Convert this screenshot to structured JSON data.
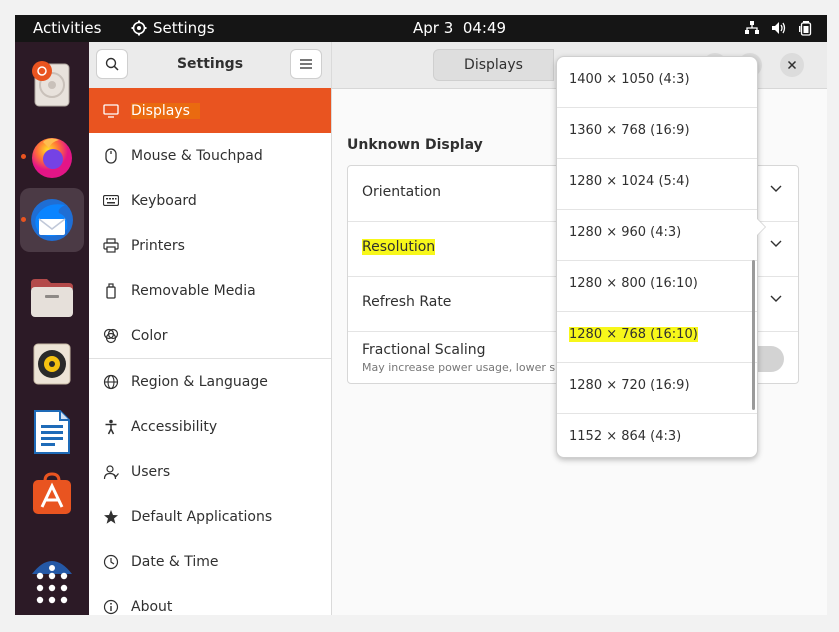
{
  "topbar": {
    "activities": "Activities",
    "app_name": "Settings",
    "date": "Apr 3",
    "time": "04:49"
  },
  "dock": {
    "items": [
      "ubuntu-installer",
      "firefox",
      "thunderbird",
      "files",
      "rhythmbox",
      "libreoffice-writer",
      "app-center",
      "help",
      "show-applications"
    ]
  },
  "sidebar": {
    "title": "Settings",
    "items": [
      {
        "label": "Displays",
        "icon": "display-icon"
      },
      {
        "label": "Mouse & Touchpad",
        "icon": "mouse-icon"
      },
      {
        "label": "Keyboard",
        "icon": "keyboard-icon"
      },
      {
        "label": "Printers",
        "icon": "printer-icon"
      },
      {
        "label": "Removable Media",
        "icon": "removable-media-icon"
      },
      {
        "label": "Color",
        "icon": "color-icon"
      },
      {
        "label": "Region & Language",
        "icon": "globe-icon"
      },
      {
        "label": "Accessibility",
        "icon": "accessibility-icon"
      },
      {
        "label": "Users",
        "icon": "users-icon"
      },
      {
        "label": "Default Applications",
        "icon": "star-icon"
      },
      {
        "label": "Date & Time",
        "icon": "clock-icon"
      },
      {
        "label": "About",
        "icon": "info-icon"
      }
    ]
  },
  "header": {
    "displays_tab": "Displays"
  },
  "main": {
    "display_name": "Unknown Display",
    "rows": {
      "orientation": "Orientation",
      "resolution": "Resolution",
      "refresh_rate": "Refresh Rate",
      "fractional_scaling": "Fractional Scaling",
      "fractional_scaling_sub": "May increase power usage, lower sp"
    }
  },
  "resolution_popover": {
    "options": [
      "1400 × 1050 (4:3)",
      "1360 × 768 (16:9)",
      "1280 × 1024 (5:4)",
      "1280 × 960 (4:3)",
      "1280 × 800 (16:10)",
      "1280 × 768 (16:10)",
      "1280 × 720 (16:9)",
      "1152 × 864 (4:3)"
    ],
    "highlighted": "1280 × 768 (16:10)"
  },
  "colors": {
    "accent": "#e95420",
    "highlight_yellow": "#f7f71a",
    "dock_bg": "#2c1a26",
    "topbar_bg": "#151515"
  }
}
